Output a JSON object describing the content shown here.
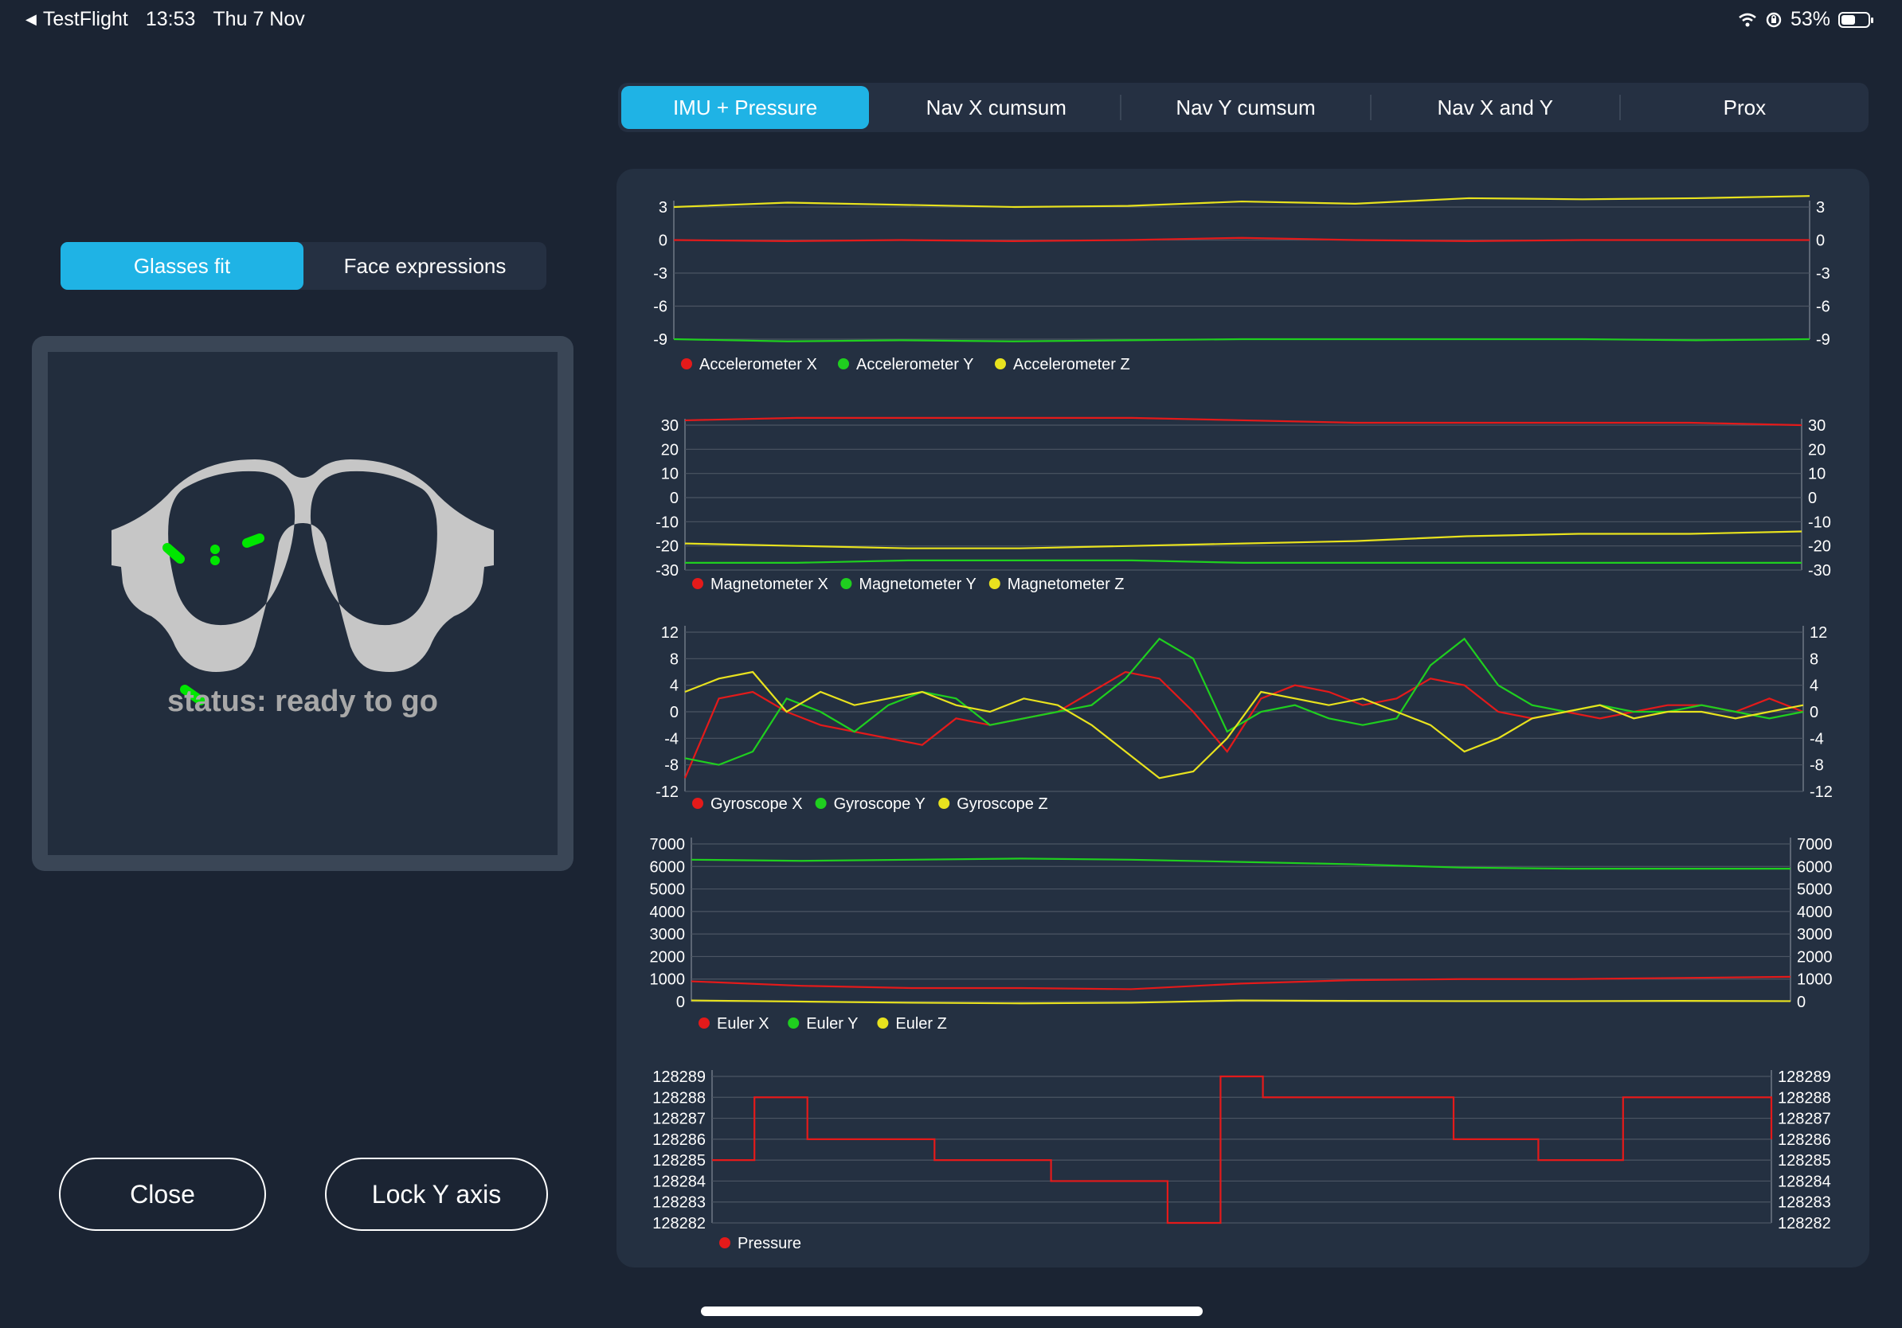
{
  "status_bar": {
    "back_app": "TestFlight",
    "time": "13:53",
    "date": "Thu 7 Nov",
    "battery": "53%",
    "battery_level": 0.53,
    "icons": [
      "wifi-icon",
      "orientation-lock-icon",
      "battery-icon"
    ]
  },
  "left_panel": {
    "segments": [
      {
        "label": "Glasses fit",
        "active": true
      },
      {
        "label": "Face expressions",
        "active": false
      }
    ],
    "status": "status: ready to go",
    "sensor_color": "#00e600",
    "buttons": {
      "close": "Close",
      "lock_y": "Lock Y axis"
    }
  },
  "tabs": [
    {
      "label": "IMU + Pressure",
      "active": true
    },
    {
      "label": "Nav X cumsum",
      "active": false
    },
    {
      "label": "Nav Y cumsum",
      "active": false
    },
    {
      "label": "Nav X and Y",
      "active": false
    },
    {
      "label": "Prox",
      "active": false
    }
  ],
  "colors": {
    "accent": "#1fb3e5",
    "series_red": "#e41a1a",
    "series_green": "#1fcf1f",
    "series_yellow": "#e8e21e"
  },
  "chart_data": [
    {
      "type": "line",
      "yticks": [
        "3",
        "0",
        "-3",
        "-6",
        "-9"
      ],
      "ylim": [
        -9,
        3
      ],
      "grid": true,
      "legend_placement": "bottom-left",
      "x": [
        0,
        10,
        20,
        30,
        40,
        50,
        60,
        70,
        80,
        90,
        100
      ],
      "series": [
        {
          "name": "Accelerometer X",
          "color": "#e41a1a",
          "values": [
            0.0,
            -0.1,
            0.0,
            -0.1,
            0.0,
            0.2,
            0.0,
            -0.1,
            0.0,
            0.0,
            0.0
          ]
        },
        {
          "name": "Accelerometer Y",
          "color": "#1fcf1f",
          "values": [
            -9.0,
            -9.2,
            -9.1,
            -9.2,
            -9.1,
            -9.0,
            -9.0,
            -9.0,
            -9.0,
            -9.1,
            -9.0
          ]
        },
        {
          "name": "Accelerometer Z",
          "color": "#e8e21e",
          "values": [
            3.0,
            3.4,
            3.2,
            3.0,
            3.1,
            3.5,
            3.3,
            3.8,
            3.7,
            3.8,
            4.0
          ]
        }
      ]
    },
    {
      "type": "line",
      "yticks": [
        "30",
        "20",
        "10",
        "0",
        "-10",
        "-20",
        "-30"
      ],
      "ylim": [
        -30,
        30
      ],
      "grid": true,
      "legend_placement": "bottom-left",
      "x": [
        0,
        10,
        20,
        30,
        40,
        50,
        60,
        70,
        80,
        90,
        100
      ],
      "series": [
        {
          "name": "Magnetometer X",
          "color": "#e41a1a",
          "values": [
            32,
            33,
            33,
            33,
            33,
            32,
            31,
            31,
            31,
            31,
            30
          ]
        },
        {
          "name": "Magnetometer Y",
          "color": "#1fcf1f",
          "values": [
            -27,
            -27,
            -26,
            -26,
            -26,
            -27,
            -27,
            -27,
            -27,
            -27,
            -27
          ]
        },
        {
          "name": "Magnetometer Z",
          "color": "#e8e21e",
          "values": [
            -19,
            -20,
            -21,
            -21,
            -20,
            -19,
            -18,
            -16,
            -15,
            -15,
            -14
          ]
        }
      ]
    },
    {
      "type": "line",
      "yticks": [
        "12",
        "8",
        "4",
        "0",
        "-4",
        "-8",
        "-12"
      ],
      "ylim": [
        -12,
        12
      ],
      "grid": true,
      "legend_placement": "bottom-left",
      "x": [
        0,
        3,
        6,
        9,
        12,
        15,
        18,
        21,
        24,
        27,
        30,
        33,
        36,
        39,
        42,
        45,
        48,
        51,
        54,
        57,
        60,
        63,
        66,
        69,
        72,
        75,
        78,
        81,
        84,
        87,
        90,
        93,
        96,
        99
      ],
      "series": [
        {
          "name": "Gyroscope X",
          "color": "#e41a1a",
          "values": [
            -10,
            2,
            3,
            0,
            -2,
            -3,
            -4,
            -5,
            -1,
            -2,
            -1,
            0,
            3,
            6,
            5,
            0,
            -6,
            2,
            4,
            3,
            1,
            2,
            5,
            4,
            0,
            -1,
            0,
            -1,
            0,
            1,
            1,
            0,
            2,
            0
          ]
        },
        {
          "name": "Gyroscope Y",
          "color": "#1fcf1f",
          "values": [
            -7,
            -8,
            -6,
            2,
            0,
            -3,
            1,
            3,
            2,
            -2,
            -1,
            0,
            1,
            5,
            11,
            8,
            -3,
            0,
            1,
            -1,
            -2,
            -1,
            7,
            11,
            4,
            1,
            0,
            1,
            0,
            0,
            1,
            0,
            -1,
            0
          ]
        },
        {
          "name": "Gyroscope Z",
          "color": "#e8e21e",
          "values": [
            3,
            5,
            6,
            0,
            3,
            1,
            2,
            3,
            1,
            0,
            2,
            1,
            -2,
            -6,
            -10,
            -9,
            -4,
            3,
            2,
            1,
            2,
            0,
            -2,
            -6,
            -4,
            -1,
            0,
            1,
            -1,
            0,
            0,
            -1,
            0,
            1
          ]
        }
      ]
    },
    {
      "type": "line",
      "yticks": [
        "7000",
        "6000",
        "5000",
        "4000",
        "3000",
        "2000",
        "1000",
        "0"
      ],
      "ylim": [
        0,
        7000
      ],
      "grid": true,
      "legend_placement": "bottom-left",
      "x": [
        0,
        10,
        20,
        30,
        40,
        50,
        60,
        70,
        80,
        90,
        100
      ],
      "series": [
        {
          "name": "Euler X",
          "color": "#e41a1a",
          "values": [
            900,
            700,
            600,
            600,
            550,
            800,
            950,
            1000,
            1000,
            1050,
            1100
          ]
        },
        {
          "name": "Euler Y",
          "color": "#1fcf1f",
          "values": [
            6300,
            6250,
            6300,
            6350,
            6300,
            6200,
            6100,
            5950,
            5900,
            5900,
            5900
          ]
        },
        {
          "name": "Euler Z",
          "color": "#e8e21e",
          "values": [
            50,
            0,
            -50,
            -80,
            -50,
            50,
            30,
            20,
            20,
            30,
            20
          ]
        }
      ]
    },
    {
      "type": "line",
      "yticks": [
        "128289",
        "128288",
        "128287",
        "128286",
        "128285",
        "128284",
        "128283",
        "128282"
      ],
      "ylim": [
        128282,
        128289
      ],
      "grid": true,
      "legend_placement": "bottom-left",
      "step": true,
      "x": [
        0,
        4,
        9,
        21,
        32,
        43,
        45,
        48,
        52,
        56,
        70,
        78,
        86,
        100
      ],
      "series": [
        {
          "name": "Pressure",
          "color": "#e41a1a",
          "values": [
            128285,
            128288,
            128286,
            128285,
            128284,
            128282,
            128282,
            128289,
            128288,
            128288,
            128286,
            128285,
            128288,
            128286
          ]
        }
      ]
    }
  ]
}
